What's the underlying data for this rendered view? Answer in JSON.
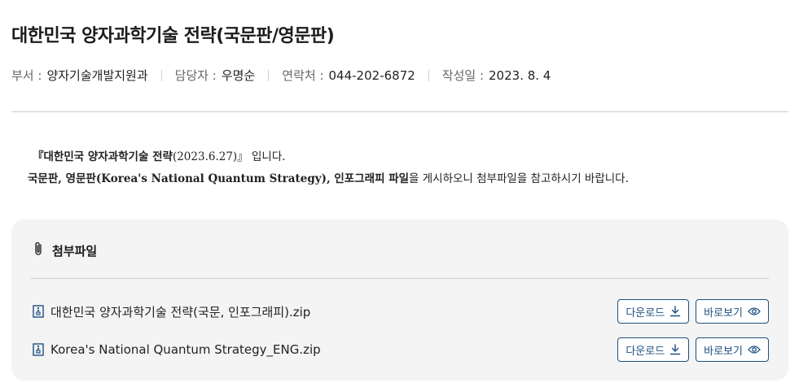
{
  "post": {
    "title": "대한민국 양자과학기술 전략(국문판/영문판)",
    "meta": {
      "dept_label": "부서 :",
      "dept_value": "양자기술개발지원과",
      "manager_label": "담당자 :",
      "manager_value": "우명순",
      "contact_label": "연락처 :",
      "contact_value": "044-202-6872",
      "date_label": "작성일 :",
      "date_value": "2023. 8. 4"
    },
    "body": {
      "line1_bold": "『대한민국 양자과학기술 전략",
      "line1_date": "(2023.6.27)",
      "line1_close": "』 입니다.",
      "line2_bold_a": "국문판, 영문판(Korea's National Quantum Strategy), 인포그래피 파일",
      "line2_rest": "을 게시하오니 첨부파일을 참고하시기 바랍니다."
    }
  },
  "attachments": {
    "heading": "첨부파일",
    "download_label": "다운로드",
    "preview_label": "바로보기",
    "files": [
      {
        "name": "대한민국 양자과학기술 전략(국문, 인포그래피).zip"
      },
      {
        "name": "Korea's National Quantum Strategy_ENG.zip"
      }
    ]
  },
  "colors": {
    "button_accent": "#1d4f80",
    "panel_bg": "#f4f4f4"
  }
}
